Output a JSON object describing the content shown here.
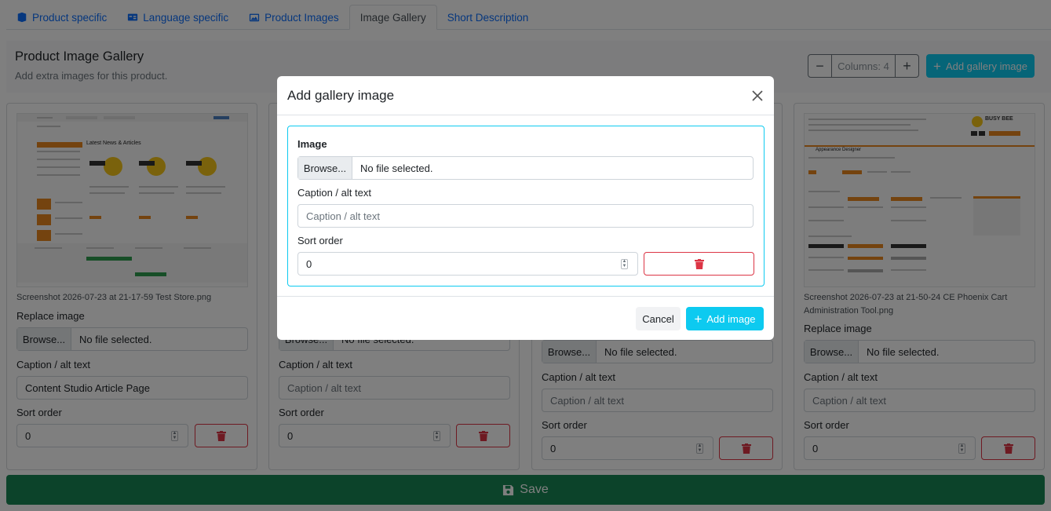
{
  "tabs": [
    {
      "label": "Product specific",
      "icon": "box-icon",
      "active": false
    },
    {
      "label": "Language specific",
      "icon": "language-icon",
      "active": false
    },
    {
      "label": "Product Images",
      "icon": "images-icon",
      "active": false
    },
    {
      "label": "Image Gallery",
      "icon": "",
      "active": true
    },
    {
      "label": "Short Description",
      "icon": "",
      "active": false
    }
  ],
  "header": {
    "title": "Product Image Gallery",
    "subtitle": "Add extra images for this product.",
    "columns_label": "Columns: 4",
    "minus": "−",
    "plus": "+",
    "add_button": "Add gallery image"
  },
  "cards": [
    {
      "filename": "Screenshot 2026-07-23 at 21-17-59 Test Store.png",
      "replace_label": "Replace image",
      "browse": "Browse...",
      "no_file": "No file selected.",
      "caption_label": "Caption / alt text",
      "caption_value": "Content Studio Article Page",
      "sort_label": "Sort order",
      "sort_value": "0"
    },
    {
      "filename": "",
      "replace_label": "",
      "browse": "Browse...",
      "no_file": "No file selected.",
      "caption_label": "Caption / alt text",
      "caption_placeholder": "Caption / alt text",
      "sort_label": "Sort order",
      "sort_value": "0"
    },
    {
      "filename": "",
      "replace_label": "",
      "browse": "Browse...",
      "no_file": "No file selected.",
      "caption_label": "Caption / alt text",
      "caption_placeholder": "Caption / alt text",
      "sort_label": "Sort order",
      "sort_value": "0"
    },
    {
      "filename": "Screenshot 2026-07-23 at 21-50-24 CE Phoenix Cart Administration Tool.png",
      "replace_label": "Replace image",
      "browse": "Browse...",
      "no_file": "No file selected.",
      "caption_label": "Caption / alt text",
      "caption_placeholder": "Caption / alt text",
      "sort_label": "Sort order",
      "sort_value": "0"
    }
  ],
  "thumb1": {
    "heading": "Latest News & Articles"
  },
  "thumb4": {
    "heading": "Appearance Designer",
    "logo": "BUSY BEE"
  },
  "save_label": "Save",
  "modal": {
    "title": "Add gallery image",
    "image_label": "Image",
    "browse": "Browse...",
    "no_file": "No file selected.",
    "caption_label": "Caption / alt text",
    "caption_placeholder": "Caption / alt text",
    "sort_label": "Sort order",
    "sort_value": "0",
    "cancel": "Cancel",
    "add": "Add image"
  },
  "colors": {
    "link": "#0d6efd",
    "info": "#0dcaf0",
    "danger": "#dc3545",
    "success": "#198754"
  }
}
